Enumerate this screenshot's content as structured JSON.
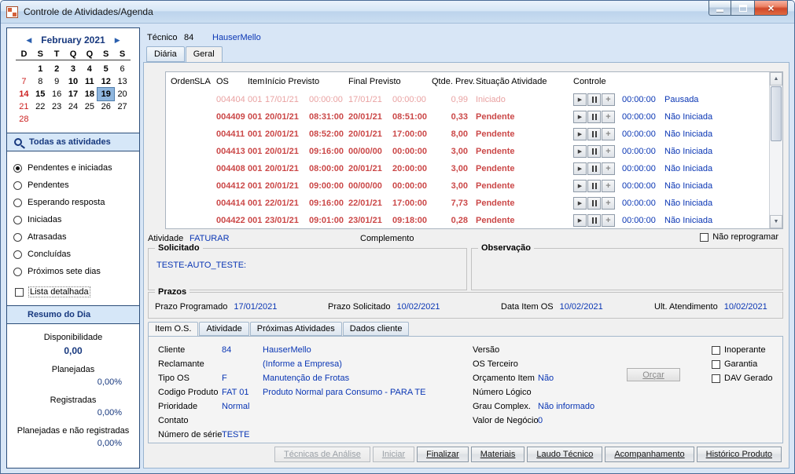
{
  "window": {
    "title": "Controle de Atividades/Agenda"
  },
  "icons": {
    "prev": "◀",
    "next": "▶",
    "play": "▶",
    "plus": "+",
    "up": "▲",
    "down": "▼",
    "close": "×"
  },
  "calendar": {
    "month_label": "February 2021",
    "day_headers": [
      "D",
      "S",
      "T",
      "Q",
      "Q",
      "S",
      "S"
    ],
    "selected_day": "19",
    "cells": [
      {
        "t": "",
        "c": ""
      },
      {
        "t": "1",
        "c": "bold"
      },
      {
        "t": "2",
        "c": "bold"
      },
      {
        "t": "3",
        "c": "bold"
      },
      {
        "t": "4",
        "c": "bold"
      },
      {
        "t": "5",
        "c": "bold"
      },
      {
        "t": "6",
        "c": ""
      },
      {
        "t": "7",
        "c": "red"
      },
      {
        "t": "8",
        "c": ""
      },
      {
        "t": "9",
        "c": ""
      },
      {
        "t": "10",
        "c": "bold"
      },
      {
        "t": "11",
        "c": "bold"
      },
      {
        "t": "12",
        "c": "bold"
      },
      {
        "t": "13",
        "c": ""
      },
      {
        "t": "14",
        "c": "red bold"
      },
      {
        "t": "15",
        "c": "bold"
      },
      {
        "t": "16",
        "c": ""
      },
      {
        "t": "17",
        "c": "bold"
      },
      {
        "t": "18",
        "c": "bold"
      },
      {
        "t": "19",
        "c": "bold selected"
      },
      {
        "t": "20",
        "c": ""
      },
      {
        "t": "21",
        "c": "red"
      },
      {
        "t": "22",
        "c": ""
      },
      {
        "t": "23",
        "c": ""
      },
      {
        "t": "24",
        "c": ""
      },
      {
        "t": "25",
        "c": ""
      },
      {
        "t": "26",
        "c": ""
      },
      {
        "t": "27",
        "c": ""
      },
      {
        "t": "28",
        "c": "red"
      },
      {
        "t": "",
        "c": ""
      },
      {
        "t": "",
        "c": ""
      },
      {
        "t": "",
        "c": ""
      },
      {
        "t": "",
        "c": ""
      },
      {
        "t": "",
        "c": ""
      },
      {
        "t": "",
        "c": ""
      }
    ]
  },
  "filters": {
    "header": "Todas as atividades",
    "options": [
      {
        "label": "Pendentes e iniciadas",
        "state": "checked"
      },
      {
        "label": "Pendentes",
        "state": ""
      },
      {
        "label": "Esperando resposta",
        "state": ""
      },
      {
        "label": "Iniciadas",
        "state": ""
      },
      {
        "label": "Atrasadas",
        "state": ""
      },
      {
        "label": "Concluídas",
        "state": ""
      },
      {
        "label": "Próximos sete dias",
        "state": ""
      }
    ],
    "detail_checkbox": "Lista detalhada"
  },
  "summary": {
    "header": "Resumo do Dia",
    "rows": [
      {
        "label": "Disponibilidade",
        "value": "0,00",
        "style": "big"
      },
      {
        "label": "Planejadas",
        "value": "0,00%",
        "style": "pct"
      },
      {
        "label": "Registradas",
        "value": "0,00%",
        "style": "pct"
      },
      {
        "label": "Planejadas e não registradas",
        "value": "0,00%",
        "style": "pct"
      }
    ]
  },
  "header": {
    "tecnico_label": "Técnico",
    "tecnico_code": "84",
    "tecnico_name": "HauserMello"
  },
  "tabs": [
    {
      "label": "Diária",
      "state": ""
    },
    {
      "label": "Geral",
      "state": "active"
    }
  ],
  "table": {
    "columns": [
      "Ordem",
      "SLA",
      "OS",
      "Item",
      "Início Previsto",
      "Final Previsto",
      "Qtde. Prev.",
      "Situação Atividade",
      "Controle"
    ],
    "rows": [
      {
        "os": "004404",
        "item": "001",
        "sd": "17/01/21",
        "st": "00:00:00",
        "ed": "17/01/21",
        "et": "00:00:00",
        "qty": "0,99",
        "status": "Iniciado",
        "timer": "00:00:00",
        "state": "Pausada",
        "cls": "started"
      },
      {
        "os": "004409",
        "item": "001",
        "sd": "20/01/21",
        "st": "08:31:00",
        "ed": "20/01/21",
        "et": "08:51:00",
        "qty": "0,33",
        "status": "Pendente",
        "timer": "00:00:00",
        "state": "Não Iniciada",
        "cls": "pending"
      },
      {
        "os": "004411",
        "item": "001",
        "sd": "20/01/21",
        "st": "08:52:00",
        "ed": "20/01/21",
        "et": "17:00:00",
        "qty": "8,00",
        "status": "Pendente",
        "timer": "00:00:00",
        "state": "Não Iniciada",
        "cls": "pending"
      },
      {
        "os": "004413",
        "item": "001",
        "sd": "20/01/21",
        "st": "09:16:00",
        "ed": "00/00/00",
        "et": "00:00:00",
        "qty": "3,00",
        "status": "Pendente",
        "timer": "00:00:00",
        "state": "Não Iniciada",
        "cls": "pending"
      },
      {
        "os": "004408",
        "item": "001",
        "sd": "20/01/21",
        "st": "08:00:00",
        "ed": "20/01/21",
        "et": "20:00:00",
        "qty": "3,00",
        "status": "Pendente",
        "timer": "00:00:00",
        "state": "Não Iniciada",
        "cls": "pending"
      },
      {
        "os": "004412",
        "item": "001",
        "sd": "20/01/21",
        "st": "09:00:00",
        "ed": "00/00/00",
        "et": "00:00:00",
        "qty": "3,00",
        "status": "Pendente",
        "timer": "00:00:00",
        "state": "Não Iniciada",
        "cls": "pending"
      },
      {
        "os": "004414",
        "item": "001",
        "sd": "22/01/21",
        "st": "09:16:00",
        "ed": "22/01/21",
        "et": "17:00:00",
        "qty": "7,73",
        "status": "Pendente",
        "timer": "00:00:00",
        "state": "Não Iniciada",
        "cls": "pending"
      },
      {
        "os": "004422",
        "item": "001",
        "sd": "23/01/21",
        "st": "09:01:00",
        "ed": "23/01/21",
        "et": "09:18:00",
        "qty": "0,28",
        "status": "Pendente",
        "timer": "00:00:00",
        "state": "Não Iniciada",
        "cls": "pending"
      }
    ]
  },
  "activity": {
    "label": "Atividade",
    "value": "FATURAR",
    "complement_label": "Complemento",
    "no_reprogram": "Não reprogramar",
    "solicitado_title": "Solicitado",
    "solicitado_text": "TESTE-AUTO_TESTE:",
    "observacao_title": "Observação"
  },
  "prazos": {
    "title": "Prazos",
    "items": [
      {
        "label": "Prazo Programado",
        "value": "17/01/2021"
      },
      {
        "label": "Prazo Solicitado",
        "value": "10/02/2021"
      },
      {
        "label": "Data Item OS",
        "value": "10/02/2021"
      },
      {
        "label": "Ult. Atendimento",
        "value": "10/02/2021"
      }
    ]
  },
  "detail_tabs": [
    {
      "label": "Item O.S.",
      "state": "active"
    },
    {
      "label": "Atividade",
      "state": ""
    },
    {
      "label": "Próximas Atividades",
      "state": ""
    },
    {
      "label": "Dados cliente",
      "state": ""
    }
  ],
  "detail": {
    "left": [
      {
        "label": "Cliente",
        "code": "84",
        "value": "HauserMello"
      },
      {
        "label": "Reclamante",
        "code": "",
        "value": "(Informe a Empresa)"
      },
      {
        "label": "Tipo OS",
        "code": "F",
        "value": "Manutenção de Frotas"
      },
      {
        "label": "Codigo Produto",
        "code": "FAT 01",
        "value": "Produto Normal para Consumo - PARA TE"
      },
      {
        "label": "Prioridade",
        "code": "Normal",
        "value": ""
      },
      {
        "label": "Contato",
        "code": "",
        "value": ""
      },
      {
        "label": "Número de série",
        "code": "TESTE",
        "value": ""
      }
    ],
    "right": [
      {
        "label": "Versão",
        "value": ""
      },
      {
        "label": "OS Terceiro",
        "value": ""
      },
      {
        "label": "Orçamento Item",
        "value": "Não"
      },
      {
        "label": "Número Lógico",
        "value": ""
      },
      {
        "label": "Grau Complex.",
        "value": "Não informado"
      },
      {
        "label": "Valor de Negócio",
        "value": "0"
      }
    ],
    "checkboxes": [
      "Inoperante",
      "Garantia",
      "DAV Gerado"
    ],
    "orcar_button": "Orçar"
  },
  "footer_buttons": [
    {
      "label": "Técnicas de Análise",
      "state": "disabled"
    },
    {
      "label": "Iniciar",
      "state": "disabled"
    },
    {
      "label": "Finalizar",
      "state": ""
    },
    {
      "label": "Materiais",
      "state": ""
    },
    {
      "label": "Laudo Técnico",
      "state": ""
    },
    {
      "label": "Acompanhamento",
      "state": ""
    },
    {
      "label": "Histórico Produto",
      "state": ""
    }
  ],
  "colors": {
    "link_blue": "#0a36b4",
    "navy": "#17387e",
    "pending_red": "#cb4848",
    "started_pink": "#e9a2a2",
    "calendar_red": "#cc2020"
  }
}
